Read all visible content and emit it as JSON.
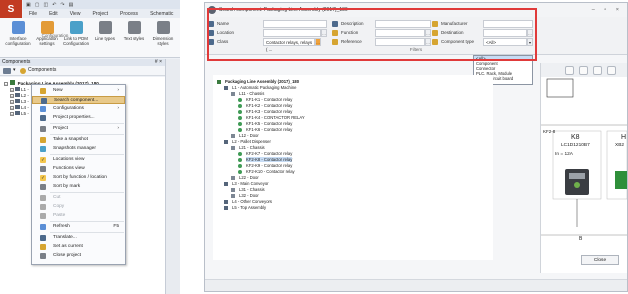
{
  "left_app": {
    "app_menu_glyph": "S",
    "menu_tabs": [
      "File",
      "Edit",
      "View",
      "Project",
      "Process",
      "Schematic"
    ],
    "ribbon_buttons": [
      {
        "label": "Interface configuration",
        "icon": "interface-config-icon",
        "color": "#5b8fd6"
      },
      {
        "label": "Application settings",
        "icon": "app-settings-icon",
        "color": "#e39b37"
      },
      {
        "label": "Link to PDM Configuration",
        "icon": "pdm-link-icon",
        "color": "#4aa0c9"
      },
      {
        "label": "Line types",
        "icon": "line-types-icon",
        "color": "#7a7f87"
      },
      {
        "label": "Text styles",
        "icon": "text-styles-icon",
        "color": "#7a7f87"
      },
      {
        "label": "Dimension styles",
        "icon": "dimension-styles-icon",
        "color": "#7a7f87"
      }
    ],
    "ribbon_group_label": "Configuration",
    "panel_title": "Components",
    "panel_pin": "# ×",
    "toolbar_label": "Components",
    "tree": {
      "root": "Packaging Line Assembly (2017)_180",
      "children": [
        "L1 -",
        "L2 -",
        "L3 -",
        "L4 -",
        "L5 -"
      ]
    },
    "context_menu": [
      {
        "label": "New",
        "submenu": true,
        "disabled": false
      },
      {
        "label": "Search component...",
        "highlight": true,
        "disabled": false
      },
      {
        "label": "Configurations",
        "submenu": true,
        "disabled": false
      },
      {
        "label": "Project properties...",
        "disabled": false
      },
      {
        "label": "Project",
        "submenu": true,
        "disabled": false
      },
      {
        "label": "Take a snapshot",
        "disabled": false
      },
      {
        "label": "Snapshots manager",
        "disabled": false
      },
      {
        "label": "Locations view",
        "checked": true,
        "disabled": false
      },
      {
        "label": "Functions view",
        "disabled": false
      },
      {
        "label": "Sort by function / location",
        "checked": true,
        "disabled": false
      },
      {
        "label": "Sort by mark",
        "disabled": false
      },
      {
        "label": "Cut",
        "disabled": true
      },
      {
        "label": "Copy",
        "disabled": true
      },
      {
        "label": "Paste",
        "disabled": true
      },
      {
        "label": "Refresh",
        "shortcut": "F5",
        "disabled": false
      },
      {
        "label": "Translate...",
        "disabled": false
      },
      {
        "label": "Set as current",
        "disabled": false
      },
      {
        "label": "Close project",
        "disabled": false
      }
    ]
  },
  "right_win": {
    "title": "Search component: Packaging Line Assembly (2017)_180",
    "window_controls": "– ▫ ×",
    "filters": {
      "name_label": "Name",
      "name_value": "",
      "description_label": "Description",
      "description_value": "",
      "manufacturer_label": "Manufacturer",
      "manufacturer_value": "",
      "location_label": "Location",
      "location_value": "",
      "function_label": "Function",
      "function_value": "",
      "destination_label": "Destination",
      "destination_value": "",
      "class_label": "Class",
      "class_value": "Contactor relays, relays ( ...",
      "reference_label": "Reference",
      "reference_value": "",
      "component_type_label": "Component type",
      "component_type_value": "<All>",
      "caption": "Filters"
    },
    "component_type_options": [
      "<All>",
      "Component",
      "Connector",
      "PLC, Rack, Module",
      "Printed circuit board",
      "Terminal"
    ],
    "results": [
      {
        "label": "Packaging Line Assembly (2017)_180",
        "level": 0,
        "bold": true
      },
      {
        "label": "L1 - Automatic Packaging Machine",
        "level": 1
      },
      {
        "label": "L11 - Chassis",
        "level": 2
      },
      {
        "label": "KF1-K1 - Contactor relay",
        "level": 3
      },
      {
        "label": "KF1-K2 - Contactor relay",
        "level": 3
      },
      {
        "label": "KF1-K3 - Contactor relay",
        "level": 3
      },
      {
        "label": "KF1-K4 - CONTACTOR RELAY",
        "level": 3
      },
      {
        "label": "KF1-K5 - Contactor relay",
        "level": 3
      },
      {
        "label": "KF1-K6 - Contactor relay",
        "level": 3
      },
      {
        "label": "L12 - Door",
        "level": 2
      },
      {
        "label": "L2 - Pallet Dispenser",
        "level": 1
      },
      {
        "label": "L21 - Chassis",
        "level": 2
      },
      {
        "label": "KF2-K7 - Contactor relay",
        "level": 3
      },
      {
        "label": "KF2-K8 - Contactor relay",
        "level": 3,
        "selected": true
      },
      {
        "label": "KF2-K9 - Contactor relay",
        "level": 3
      },
      {
        "label": "KF2-K10 - Contactor relay",
        "level": 3
      },
      {
        "label": "L22 - Door",
        "level": 2
      },
      {
        "label": "L3 - Main Conveyor",
        "level": 1
      },
      {
        "label": "L31 - Chassis",
        "level": 2
      },
      {
        "label": "L32 - Door",
        "level": 2
      },
      {
        "label": "L4 - Other Conveyors",
        "level": 1
      },
      {
        "label": "L5 - Top Assembly",
        "level": 1
      }
    ],
    "preview": {
      "sheet_col": "KF2-8",
      "mark": "K8",
      "reference": "LC1D1210B7",
      "rating": "In = 12A",
      "second_mark_partial": "H",
      "second_ref_partial": "XB2",
      "bottom_letter": "B"
    },
    "close_label": "Close",
    "accent_red": "#e03a3a",
    "selection_blue": "#c7dcf4"
  }
}
